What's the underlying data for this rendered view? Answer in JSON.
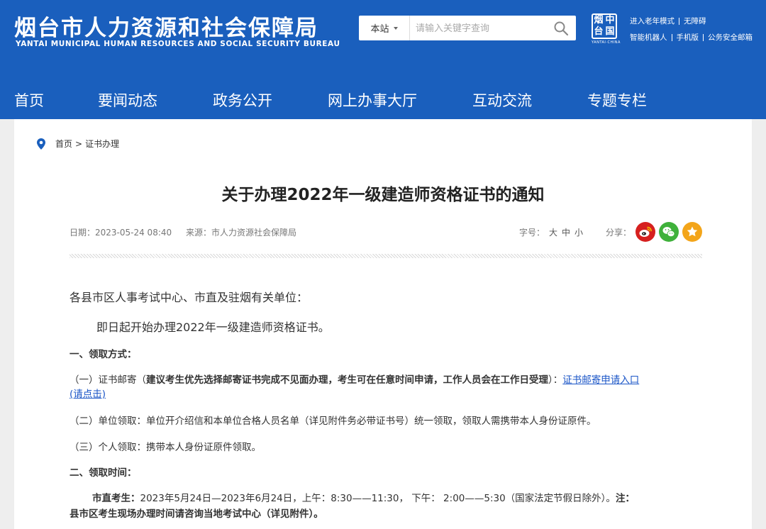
{
  "header": {
    "logo_cn": "烟台市人力资源和社会保障局",
    "logo_en": "YANTAI MUNICIPAL HUMAN RESOURCES AND SOCIAL SECURITY BUREAU",
    "search_scope": "本站",
    "search_placeholder": "请输入关键字查询",
    "emblem_chars": [
      "烟",
      "中",
      "台",
      "国"
    ],
    "emblem_en": "YANTAI·CHINA",
    "links_row1": [
      "进入老年模式",
      "无障碍"
    ],
    "links_row2": [
      "智能机器人",
      "手机版",
      "公务安全邮箱"
    ]
  },
  "nav": {
    "items": [
      "首页",
      "要闻动态",
      "政务公开",
      "网上办事大厅",
      "互动交流",
      "专题专栏"
    ]
  },
  "breadcrumb": {
    "home": "首页",
    "separator": ">",
    "current": "证书办理"
  },
  "article": {
    "title": "关于办理2022年一级建造师资格证书的通知",
    "date": "日期：2023-05-24 08:40",
    "source": "来源：市人力资源社会保障局",
    "fontsize_label": "字号：",
    "fontsize_options": [
      "大",
      "中",
      "小"
    ],
    "share_label": "分享：",
    "salutation": "各县市区人事考试中心、市直及驻烟有关单位：",
    "intro": "即日起开始办理2022年一级建造师资格证书。",
    "section1_heading": "一、领取方式：",
    "item1_prefix": "（一）证书邮寄（",
    "item1_bold": "建议考生优先选择邮寄证书完成不见面办理，考生可在任意时间申请，工作人员会在工作日受理",
    "item1_suffix": "）：",
    "item1_link_a": "证书邮寄申请入口",
    "item1_link_b": "(请点击)",
    "item2": "（二）单位领取：单位开介绍信和本单位合格人员名单（详见附件务必带证书号）统一领取，领取人需携带本人身份证原件。",
    "item3": "（三）个人领取：携带本人身份证原件领取。",
    "section2_heading": "二、领取时间：",
    "time_label": "市直考生：",
    "time_text": "2023年5月24日—2023年6月24日，上午：8:30——11:30，  下午：  2:00——5:30（国家法定节假日除外）。",
    "time_note_a": "注：",
    "time_note_b": "县市区考生现场办理时间请咨询当地考试中心（详见附件）。"
  },
  "colors": {
    "brand_blue": "#1a5fbd",
    "link_blue": "#1a55c7",
    "weibo_red": "#d6201f",
    "wechat_green": "#3fb13b",
    "favorite_orange": "#f3a51a"
  },
  "icons": {
    "search": "search-icon",
    "location": "location-pin-icon",
    "weibo": "weibo-icon",
    "wechat": "wechat-icon",
    "favorite": "star-icon"
  }
}
